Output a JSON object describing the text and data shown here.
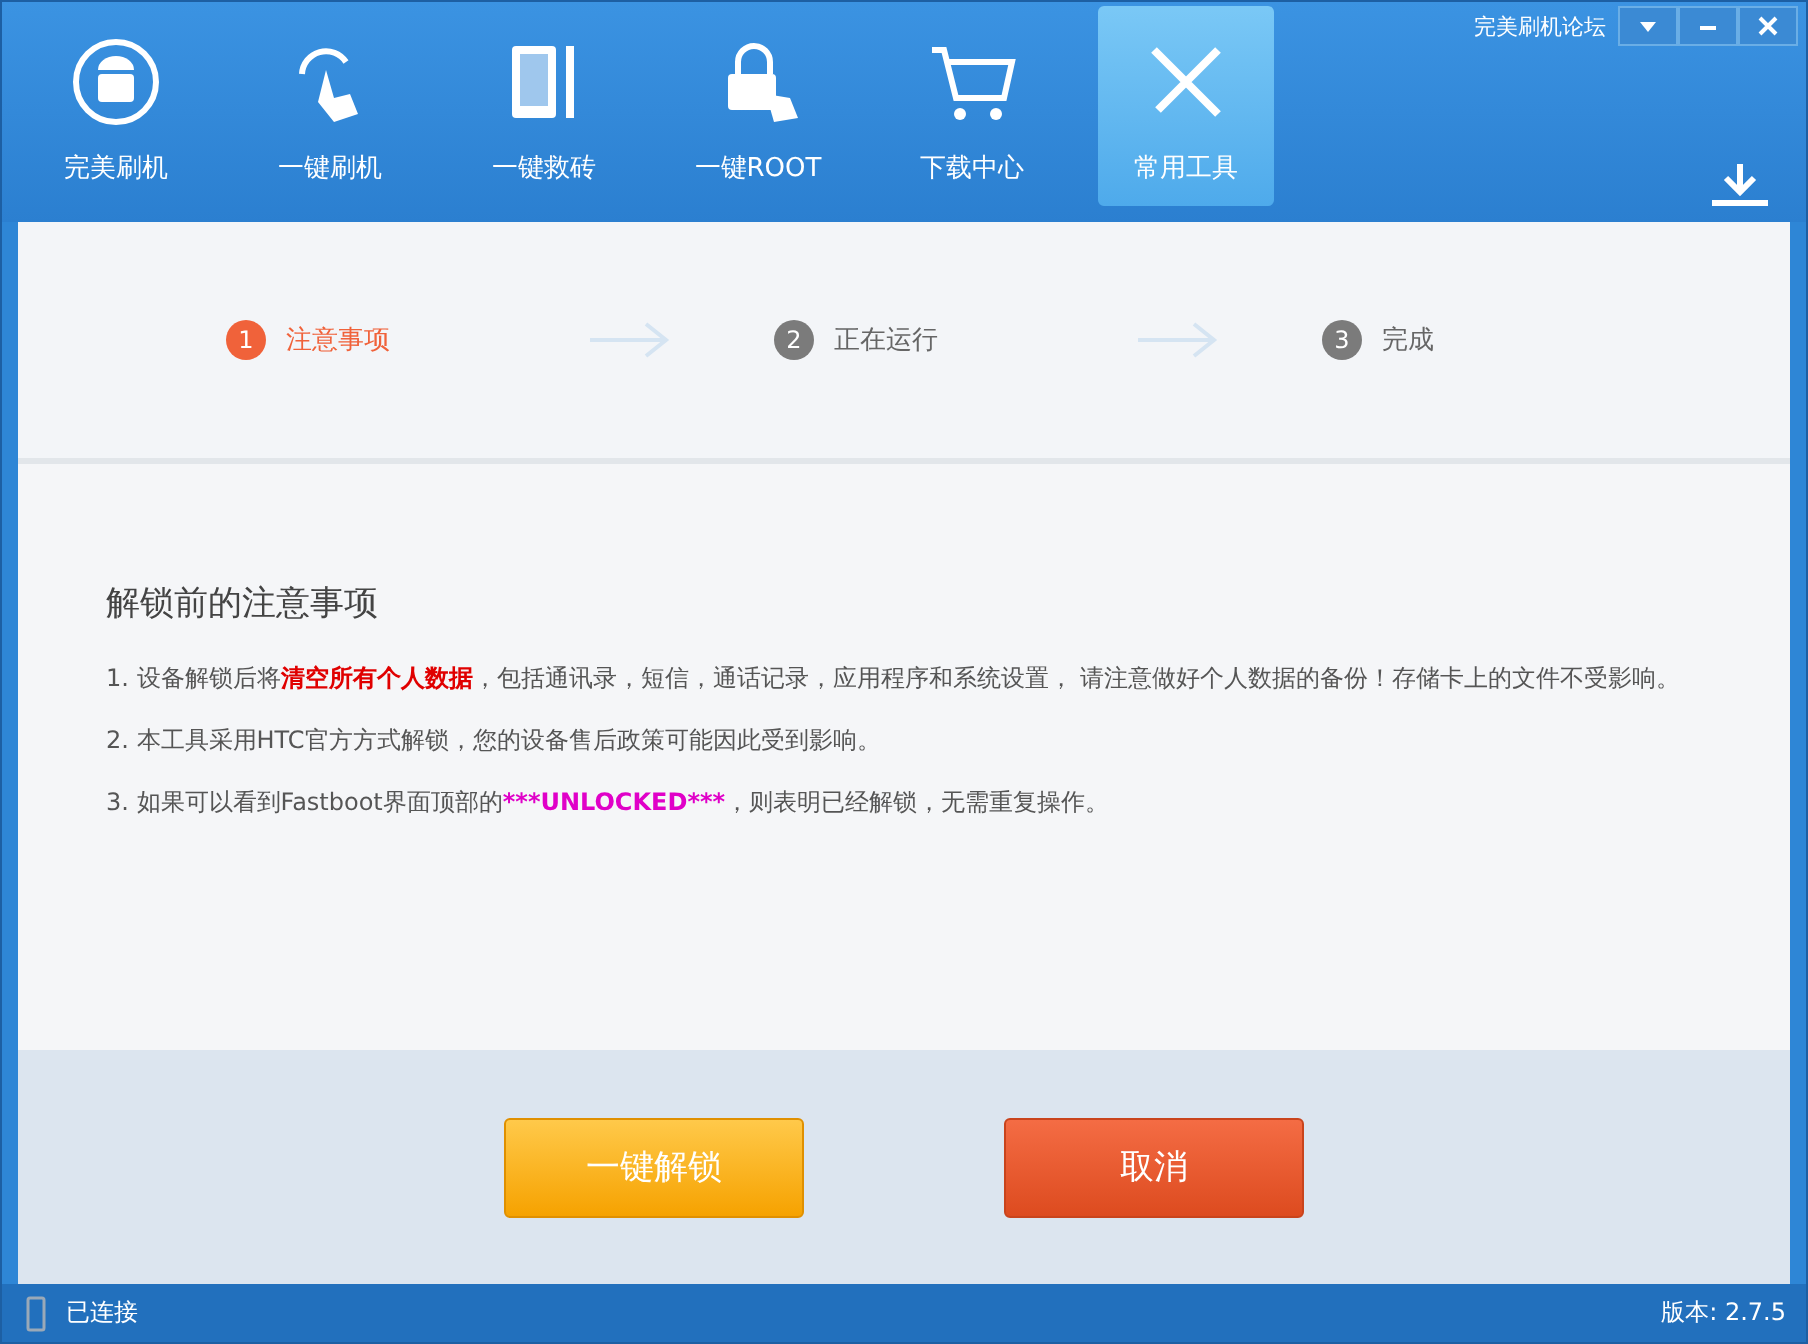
{
  "window": {
    "forum_link": "完美刷机论坛"
  },
  "tabs": [
    {
      "label": "完美刷机",
      "selected": false
    },
    {
      "label": "一键刷机",
      "selected": false
    },
    {
      "label": "一键救砖",
      "selected": false
    },
    {
      "label": "一键ROOT",
      "selected": false
    },
    {
      "label": "下载中心",
      "selected": false
    },
    {
      "label": "常用工具",
      "selected": true
    }
  ],
  "steps": [
    {
      "number": "1",
      "label": "注意事项",
      "selected": true
    },
    {
      "number": "2",
      "label": "正在运行",
      "selected": false
    },
    {
      "number": "3",
      "label": "完成",
      "selected": false
    }
  ],
  "notice": {
    "title": "解锁前的注意事项",
    "items": [
      {
        "before": "1. 设备解锁后将",
        "highlight": "清空所有个人数据",
        "after": "，包括通讯录，短信，通话记录，应用程序和系统设置， 请注意做好个人数据的备份！存储卡上的文件不受影响。",
        "color": "#e00000"
      },
      {
        "before": "2. 本工具采用HTC官方方式解锁，您的设备售后政策可能因此受到影响。"
      },
      {
        "before": "3. 如果可以看到Fastboot界面顶部的",
        "highlight": "***UNLOCKED***",
        "after": "，则表明已经解锁，无需重复操作。",
        "color": "#e000c8"
      }
    ]
  },
  "buttons": [
    {
      "label": "一键解锁",
      "kind": "primary"
    },
    {
      "label": "取消",
      "kind": "cancel"
    }
  ],
  "status_bar": {
    "connection": "已连接",
    "version": "版本: 2.7.5"
  }
}
